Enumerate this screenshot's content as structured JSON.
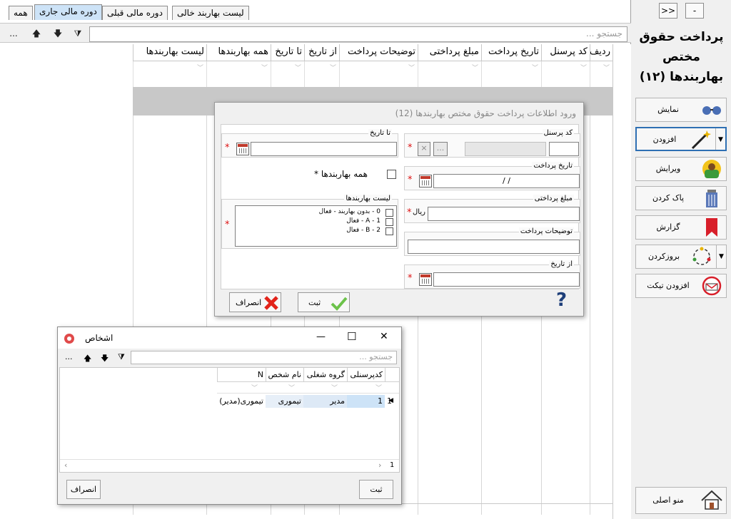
{
  "tabs": [
    "همه",
    "دوره مالی جاری",
    "دوره مالی قبلی",
    "لیست بهاربند خالی"
  ],
  "active_tab": "دوره مالی جاری",
  "toolbar": {
    "more": "...",
    "up": "🡅",
    "down": "🡇",
    "filter": "⧩",
    "search_placeholder": "جستجو ..."
  },
  "grid": {
    "columns": [
      "ردیف",
      "کد پرسنل",
      "تاریخ پرداخت",
      "مبلغ پرداختی",
      "توضیحات پرداخت",
      "از تاریخ",
      "تا تاریخ",
      "همه بهاربندها",
      "لیست بهاربندها"
    ]
  },
  "panel": {
    "collapse_label": ">>",
    "minimize_label": "-",
    "title": "پرداخت حقوق مختص بهاربندها (۱۲)",
    "actions": {
      "show": "نمایش",
      "add": "افزودن",
      "edit": "ویرایش",
      "delete": "پاک کردن",
      "report": "گزارش",
      "refresh": "بروزکردن",
      "add_ticket": "افزودن تیکت"
    },
    "main_menu": "منو اصلی"
  },
  "dialog": {
    "title": "ورود اطلاعات پرداخت حقوق مختص بهاربندها (12)",
    "personnel_code_label": "کد پرسنل",
    "payment_date_label": "تاریخ پرداخت",
    "payment_date_value": "/ /",
    "amount_label": "مبلغ پرداختی",
    "currency": "ریال",
    "description_label": "توضیحات پرداخت",
    "from_date_label": "از تاریخ",
    "to_date_label": "تا تاریخ",
    "all_barns_label": "همه بهاربندها *",
    "barn_list_label": "لیست بهاربندها",
    "barn_items": [
      "0 - بدون بهاربند - فعال",
      "A - 1 - فعال",
      "B - 2 - فعال"
    ],
    "ellipsis": "...",
    "clear_x": "×",
    "required": "*",
    "save": "ثبت",
    "cancel": "انصراف",
    "help": "?"
  },
  "persons": {
    "title": "اشخاص",
    "search_placeholder": "جستجو ...",
    "columns": [
      "کدپرسنلی",
      "گروه شغلی",
      "نام شخص",
      "N"
    ],
    "rows": [
      {
        "index": "1",
        "code": "1",
        "job": "مدیر",
        "name": "تیموری",
        "n": "تیموری(مدیر)"
      }
    ],
    "footer_count": "1",
    "save": "ثبت",
    "cancel": "انصراف",
    "close_glyph": "✕",
    "max_glyph": "☐",
    "min_glyph": "—"
  },
  "colors": {
    "accent_blue": "#2e6fb3",
    "selected_row": "#c8c8c8",
    "active_tab": "#cde3f7",
    "required_red": "#d11111"
  }
}
